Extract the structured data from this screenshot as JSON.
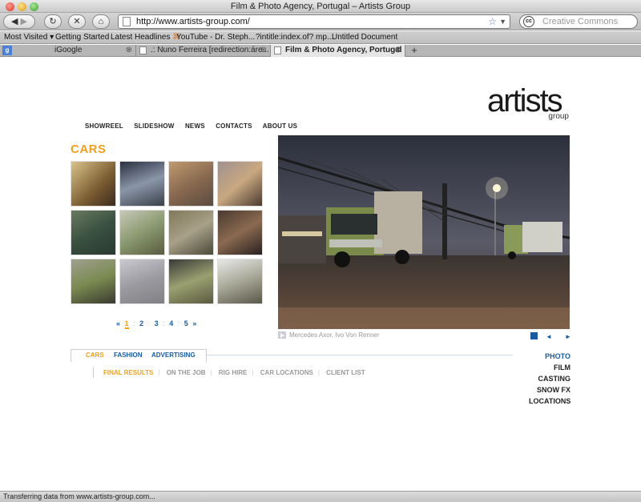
{
  "window": {
    "title": "Film & Photo Agency, Portugal – Artists Group"
  },
  "toolbar": {
    "url": "http://www.artists-group.com/",
    "search_placeholder": "Creative Commons"
  },
  "bookmarks": [
    "Most Visited",
    "Getting Started",
    "Latest Headlines",
    "YouTube - Dr. Steph...",
    "?intitle:index.of? mp...",
    "Untitled Document"
  ],
  "tabs": [
    {
      "label": "iGoogle"
    },
    {
      "label": ".: Nuno Ferreira [redirection:áre..."
    },
    {
      "label": "Film & Photo Agency, Portugal ..."
    }
  ],
  "page": {
    "logo": {
      "word": "artists",
      "sub": "group"
    },
    "topnav": [
      "SHOWREEL",
      "SLIDESHOW",
      "NEWS",
      "CONTACTS",
      "ABOUT US"
    ],
    "section_title": "CARS",
    "pager": {
      "prev": "«",
      "pages": [
        "1",
        "2",
        "3",
        "4",
        "5"
      ],
      "next": "»",
      "current": "1"
    },
    "caption": "Mercedes Axor, Ivo Von Renner",
    "slideshow_controls": {
      "prev": "◄",
      "next": "►"
    },
    "categories": [
      "CARS",
      "FASHION",
      "ADVERTISING"
    ],
    "subnav": [
      "FINAL RESULTS",
      "ON THE JOB",
      "RIG HIRE",
      "CAR LOCATIONS",
      "CLIENT LIST"
    ],
    "right_menu": [
      "PHOTO",
      "FILM",
      "CASTING",
      "SNOW FX",
      "LOCATIONS"
    ]
  },
  "status": {
    "text": "Transferring data from www.artists-group.com..."
  },
  "colors": {
    "accent_orange": "#f0a020",
    "accent_blue": "#1a5aa0"
  }
}
